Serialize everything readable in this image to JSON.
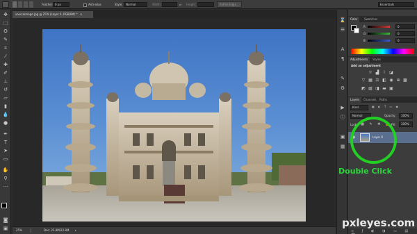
{
  "options_bar": {
    "feather_label": "Feather:",
    "feather_value": "0 px",
    "antialias_label": "Anti-alias",
    "style_label": "Style:",
    "style_value": "Normal",
    "width_label": "Width:",
    "height_label": "Height:",
    "refine_edge_label": "Refine Edge...",
    "workspace_value": "Essentials"
  },
  "document": {
    "tab_title": "sourceimage.jpg @ 25% (Layer 0, RGB/8#) *",
    "tab_close": "×"
  },
  "status_bar": {
    "zoom": "25%",
    "doc_info": "Doc: 22.8M/22.8M"
  },
  "color_panel": {
    "tabs": [
      "Color",
      "Swatches"
    ],
    "channels": [
      {
        "label": "R",
        "value": "0",
        "color": "#d23a3a"
      },
      {
        "label": "G",
        "value": "0",
        "color": "#3ab43a"
      },
      {
        "label": "B",
        "value": "0",
        "color": "#3a5ad2"
      }
    ]
  },
  "adjustments_panel": {
    "tabs": [
      "Adjustments",
      "Styles"
    ],
    "add_label": "Add an adjustment"
  },
  "layers_panel": {
    "tabs": [
      "Layers",
      "Channels",
      "Paths"
    ],
    "kind_label": "Kind",
    "blend_mode": "Normal",
    "opacity_label": "Opacity:",
    "opacity_value": "100%",
    "lock_label": "Lock:",
    "fill_label": "Fill:",
    "fill_value": "100%",
    "layer_name": "Layer 0"
  },
  "overlay": {
    "instruction": "Double Click",
    "watermark": "pxleyes.com",
    "highlight_color": "#22cf22"
  }
}
